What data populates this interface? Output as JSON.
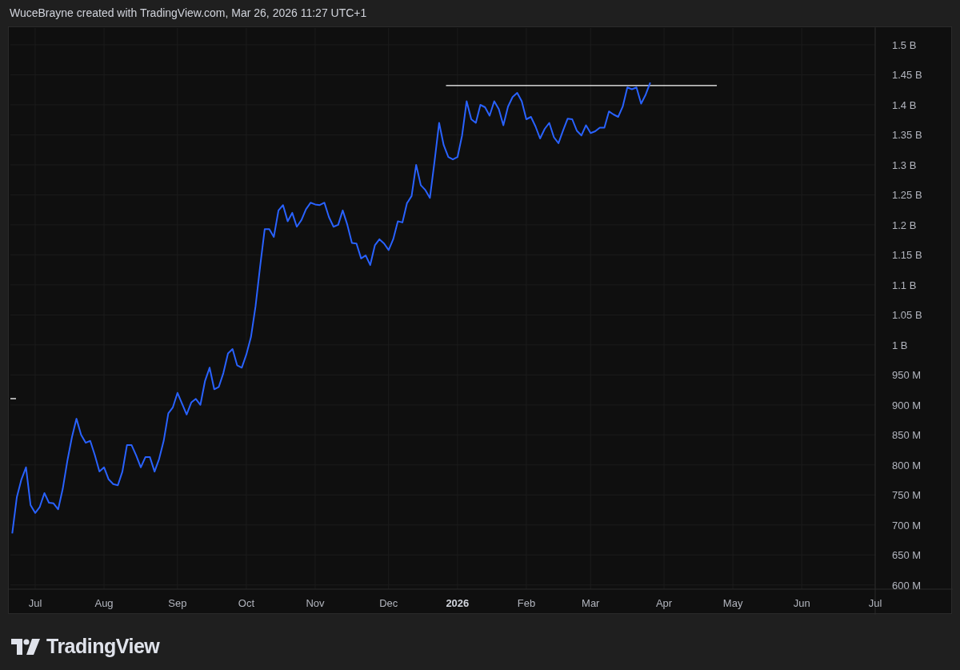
{
  "header": {
    "text": "WuceBrayne created with TradingView.com, Mar 26, 2026 11:27 UTC+1"
  },
  "chart": {
    "chart_data": {
      "type": "line",
      "categories": [
        null,
        null,
        null,
        null,
        null,
        "Jul",
        null,
        null,
        null,
        null,
        null,
        null,
        null,
        null,
        null,
        null,
        null,
        null,
        null,
        null,
        "Aug",
        null,
        null,
        null,
        null,
        null,
        null,
        null,
        null,
        null,
        null,
        null,
        null,
        null,
        null,
        null,
        "Sep",
        null,
        null,
        null,
        null,
        null,
        null,
        null,
        null,
        null,
        null,
        null,
        null,
        null,
        null,
        "Oct",
        null,
        null,
        null,
        null,
        null,
        null,
        null,
        null,
        null,
        null,
        null,
        null,
        null,
        null,
        "Nov",
        null,
        null,
        null,
        null,
        null,
        null,
        null,
        null,
        null,
        null,
        null,
        null,
        null,
        null,
        null,
        "Dec",
        null,
        null,
        null,
        null,
        null,
        null,
        null,
        null,
        null,
        null,
        null,
        null,
        null,
        null,
        "**2026**",
        null,
        null,
        null,
        null,
        null,
        null,
        null,
        null,
        null,
        null,
        null,
        null,
        null,
        null,
        "Feb",
        null,
        null,
        null,
        null,
        null,
        null,
        null,
        null,
        null,
        null,
        null,
        null,
        null,
        "Mar",
        null,
        null,
        null,
        null,
        null,
        null,
        null,
        null,
        null,
        null,
        null,
        null,
        null,
        null,
        null,
        "Apr",
        null,
        null,
        null,
        null,
        null,
        null,
        null,
        null,
        null,
        null,
        null,
        null,
        null,
        null,
        "May",
        null,
        null,
        null,
        null,
        null,
        null,
        null,
        null,
        null,
        null,
        null,
        null,
        null,
        null,
        "Jun",
        null,
        null,
        null,
        null,
        null,
        null,
        null,
        null,
        null,
        null,
        null,
        null,
        null,
        null,
        null,
        "Jul"
      ],
      "series": [
        {
          "color": "#2962ff",
          "values": [
            686000000,
            746000000,
            776000000,
            796000000,
            733000000,
            720000000,
            730000000,
            753000000,
            737000000,
            736000000,
            726000000,
            760000000,
            806000000,
            846000000,
            877000000,
            850000000,
            837000000,
            840000000,
            816000000,
            789000000,
            796000000,
            776000000,
            768000000,
            766000000,
            789000000,
            833000000,
            833000000,
            816000000,
            796000000,
            813000000,
            813000000,
            789000000,
            810000000,
            840000000,
            886000000,
            896000000,
            920000000,
            902000000,
            884000000,
            904000000,
            910000000,
            900000000,
            940000000,
            962000000,
            926000000,
            930000000,
            953000000,
            986000000,
            993000000,
            966000000,
            962000000,
            984000000,
            1013000000,
            1064000000,
            1130000000,
            1193000000,
            1193000000,
            1180000000,
            1224000000,
            1233000000,
            1206000000,
            1220000000,
            1197000000,
            1208000000,
            1226000000,
            1237000000,
            1234000000,
            1233000000,
            1237000000,
            1213000000,
            1197000000,
            1200000000,
            1224000000,
            1200000000,
            1170000000,
            1169000000,
            1144000000,
            1149000000,
            1133000000,
            1166000000,
            1176000000,
            1169000000,
            1158000000,
            1176000000,
            1206000000,
            1204000000,
            1236000000,
            1248000000,
            1300000000,
            1266000000,
            1258000000,
            1245000000,
            1306000000,
            1370000000,
            1333000000,
            1313000000,
            1309000000,
            1313000000,
            1349000000,
            1406000000,
            1376000000,
            1370000000,
            1400000000,
            1396000000,
            1382000000,
            1406000000,
            1393000000,
            1366000000,
            1397000000,
            1413000000,
            1420000000,
            1406000000,
            1376000000,
            1380000000,
            1364000000,
            1344000000,
            1360000000,
            1370000000,
            1346000000,
            1336000000,
            1357000000,
            1377000000,
            1376000000,
            1357000000,
            1349000000,
            1366000000,
            1353000000,
            1356000000,
            1362000000,
            1362000000,
            1389000000,
            1384000000,
            1380000000,
            1397000000,
            1429000000,
            1426000000,
            1429000000,
            1402000000,
            1417000000,
            1437000000,
            null,
            null,
            null,
            null,
            null,
            null,
            null,
            null,
            null,
            null,
            null,
            null,
            null,
            null,
            null,
            null,
            null,
            null,
            null,
            null,
            null,
            null,
            null,
            null,
            null,
            null,
            null,
            null,
            null,
            null,
            null,
            null,
            null,
            null,
            null,
            null,
            null,
            null,
            null,
            null,
            null,
            null,
            null,
            null,
            null,
            null,
            null,
            null,
            null
          ]
        }
      ],
      "ylim": [
        593000000,
        1528000000
      ],
      "grid": true,
      "yticks": [
        {
          "value": 1500000000,
          "label": "1.5 B"
        },
        {
          "value": 1450000000,
          "label": "1.45 B"
        },
        {
          "value": 1400000000,
          "label": "1.4 B"
        },
        {
          "value": 1350000000,
          "label": "1.35 B"
        },
        {
          "value": 1300000000,
          "label": "1.3 B"
        },
        {
          "value": 1250000000,
          "label": "1.25 B"
        },
        {
          "value": 1200000000,
          "label": "1.2 B"
        },
        {
          "value": 1150000000,
          "label": "1.15 B"
        },
        {
          "value": 1100000000,
          "label": "1.1 B"
        },
        {
          "value": 1050000000,
          "label": "1.05 B"
        },
        {
          "value": 1000000000,
          "label": "1 B"
        },
        {
          "value": 950000000,
          "label": "950 M"
        },
        {
          "value": 900000000,
          "label": "900 M"
        },
        {
          "value": 850000000,
          "label": "850 M"
        },
        {
          "value": 800000000,
          "label": "800 M"
        },
        {
          "value": 750000000,
          "label": "750 M"
        },
        {
          "value": 700000000,
          "label": "700 M"
        },
        {
          "value": 650000000,
          "label": "650 M"
        },
        {
          "value": 600000000,
          "label": "600 M"
        }
      ],
      "ref_lines": [
        {
          "axis": "y",
          "value": 1432000000
        }
      ]
    }
  },
  "footer": {
    "brand": "TradingView"
  }
}
